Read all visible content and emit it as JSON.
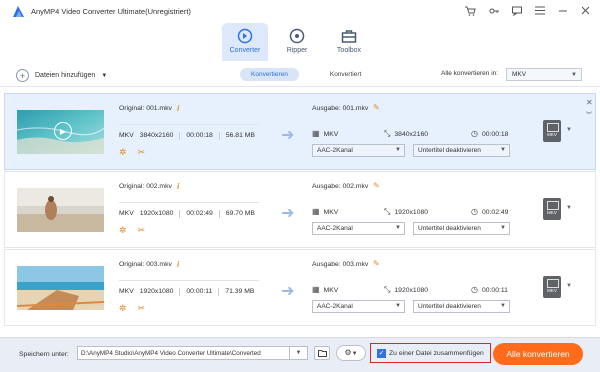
{
  "app": {
    "title": "AnyMP4 Video Converter Ultimate(Unregistriert)",
    "window_icons": [
      "cart-icon",
      "key-icon",
      "chat-icon",
      "menu-icon",
      "minimize-icon",
      "close-icon"
    ]
  },
  "tabs": [
    {
      "label": "Converter",
      "icon": "converter-icon",
      "active": true
    },
    {
      "label": "Ripper",
      "icon": "ripper-icon",
      "active": false
    },
    {
      "label": "Toolbox",
      "icon": "toolbox-icon",
      "active": false
    }
  ],
  "toolbar": {
    "add_files": "Dateien hinzufügen",
    "segments": [
      "Konvertieren",
      "Konvertiert"
    ],
    "convert_all_label": "Alle konvertieren in:",
    "convert_all_value": "MKV"
  },
  "files": [
    {
      "original": "Original: 001.mkv",
      "format": "MKV",
      "resolution": "3840x2160",
      "duration": "00:00:18",
      "size": "56.81 MB",
      "output": "Ausgabe: 001.mkv",
      "out_format": "MKV",
      "out_resolution": "3840x2160",
      "out_duration": "00:00:18",
      "audio": "AAC-2Kanal",
      "subtitle": "Untertitel deaktivieren",
      "badge": "MKV"
    },
    {
      "original": "Original: 002.mkv",
      "format": "MKV",
      "resolution": "1920x1080",
      "duration": "00:02:49",
      "size": "69.70 MB",
      "output": "Ausgabe: 002.mkv",
      "out_format": "MKV",
      "out_resolution": "1920x1080",
      "out_duration": "00:02:49",
      "audio": "AAC-2Kanal",
      "subtitle": "Untertitel deaktivieren",
      "badge": "MKV"
    },
    {
      "original": "Original: 003.mkv",
      "format": "MKV",
      "resolution": "1920x1080",
      "duration": "00:00:11",
      "size": "71.39 MB",
      "output": "Ausgabe: 003.mkv",
      "out_format": "MKV",
      "out_resolution": "1920x1080",
      "out_duration": "00:00:11",
      "audio": "AAC-2Kanal",
      "subtitle": "Untertitel deaktivieren",
      "badge": "MKV"
    }
  ],
  "bottom": {
    "save_label": "Speichern unter:",
    "save_path": "D:\\AnyMP4 Studio\\AnyMP4 Video Converter Ultimate\\Converted",
    "merge_label": "Zu einer Datei zusammenfügen",
    "merge_checked": true,
    "convert_button": "Alle konvertieren"
  },
  "colors": {
    "accent": "#2e73de",
    "convert_button": "#ff6b1a",
    "highlight_border": "#e0202a",
    "icon_orange": "#e78a22"
  }
}
